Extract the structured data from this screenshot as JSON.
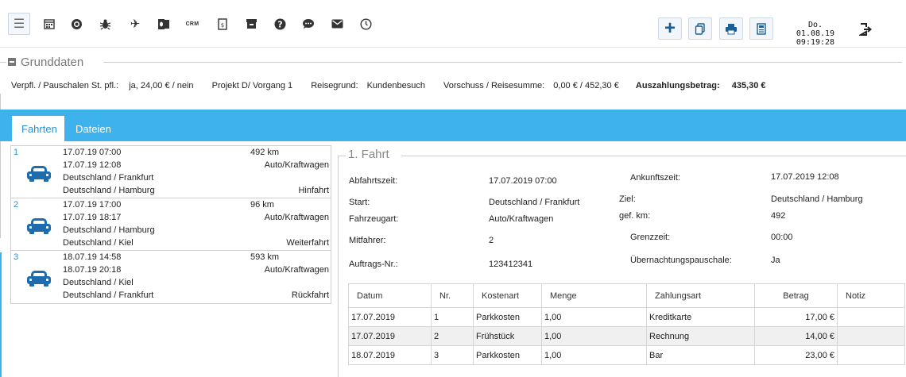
{
  "toolbar": {
    "icons": [
      "menu-icon",
      "calendar-icon",
      "target-icon",
      "bug-icon",
      "airplane-icon",
      "outlook-icon",
      "crm-icon",
      "document-icon",
      "archive-icon",
      "help-icon",
      "chat-icon",
      "mail-icon",
      "clock-icon"
    ],
    "crm_label": "CRM",
    "actions": [
      "add-icon",
      "copy-icon",
      "print-icon",
      "calculator-icon"
    ],
    "date": "Do. 01.08.19",
    "time": "09:19:28",
    "accent": "#1a5f97"
  },
  "grunddaten": {
    "title": "Grunddaten",
    "verpflegung_label": "Verpfl. / Pauschalen St. pfl.:",
    "verpflegung_value": "ja, 24,00 € / nein",
    "projekt": "Projekt D/ Vorgang 1",
    "reisegrund_label": "Reisegrund:",
    "reisegrund_value": "Kundenbesuch",
    "vorschuss_label": "Vorschuss / Reisesumme:",
    "vorschuss_value": "0,00 € / 452,30 €",
    "auszahlung_label": "Auszahlungsbetrag:",
    "auszahlung_value": "435,30 €"
  },
  "tabs": [
    {
      "label": "Fahrten",
      "active": true
    },
    {
      "label": "Dateien",
      "active": false
    }
  ],
  "tab_color": "#3db2ed",
  "trips": [
    {
      "num": "1",
      "start_time": "17.07.19 07:00",
      "end_time": "17.07.19 12:08",
      "from": "Deutschland / Frankfurt",
      "to": "Deutschland / Hamburg",
      "km": "492 km",
      "vehicle": "Auto/Kraftwagen",
      "type": "Hinfahrt"
    },
    {
      "num": "2",
      "start_time": "17.07.19 17:00",
      "end_time": "17.07.19 18:17",
      "from": "Deutschland / Hamburg",
      "to": "Deutschland / Kiel",
      "km": "96 km",
      "vehicle": "Auto/Kraftwagen",
      "type": "Weiterfahrt"
    },
    {
      "num": "3",
      "start_time": "18.07.19 14:58",
      "end_time": "18.07.19 20:18",
      "from": "Deutschland / Kiel",
      "to": "Deutschland / Frankfurt",
      "km": "593 km",
      "vehicle": "Auto/Kraftwagen",
      "type": "Rückfahrt"
    }
  ],
  "fahrt": {
    "title": "1. Fahrt",
    "abfahrt_label": "Abfahrtszeit:",
    "abfahrt_value": "17.07.2019 07:00",
    "ankunft_label": "Ankunftszeit:",
    "ankunft_value": "17.07.2019 12:08",
    "start_label": "Start:",
    "start_value": "Deutschland / Frankfurt",
    "ziel_label": "Ziel:",
    "ziel_value": "Deutschland / Hamburg",
    "fahrzeug_label": "Fahrzeugart:",
    "fahrzeug_value": "Auto/Kraftwagen",
    "km_label": "gef. km:",
    "km_value": "492",
    "mitfahrer_label": "Mitfahrer:",
    "mitfahrer_value": "2",
    "grenz_label": "Grenzzeit:",
    "grenz_value": "00:00",
    "auftrag_label": "Auftrags-Nr.:",
    "auftrag_value": "123412341",
    "uebernacht_label": "Übernachtungspauschale:",
    "uebernacht_value": "Ja"
  },
  "costs": {
    "headers": [
      "Datum",
      "Nr.",
      "Kostenart",
      "Menge",
      "Zahlungsart",
      "Betrag",
      "Notiz"
    ],
    "rows": [
      [
        "17.07.2019",
        "1",
        "Parkkosten",
        "1,00",
        "Kreditkarte",
        "17,00 €",
        ""
      ],
      [
        "17.07.2019",
        "2",
        "Frühstück",
        "1,00",
        "Rechnung",
        "14,00 €",
        ""
      ],
      [
        "18.07.2019",
        "3",
        "Parkkosten",
        "1,00",
        "Bar",
        "23,00 €",
        ""
      ]
    ]
  }
}
